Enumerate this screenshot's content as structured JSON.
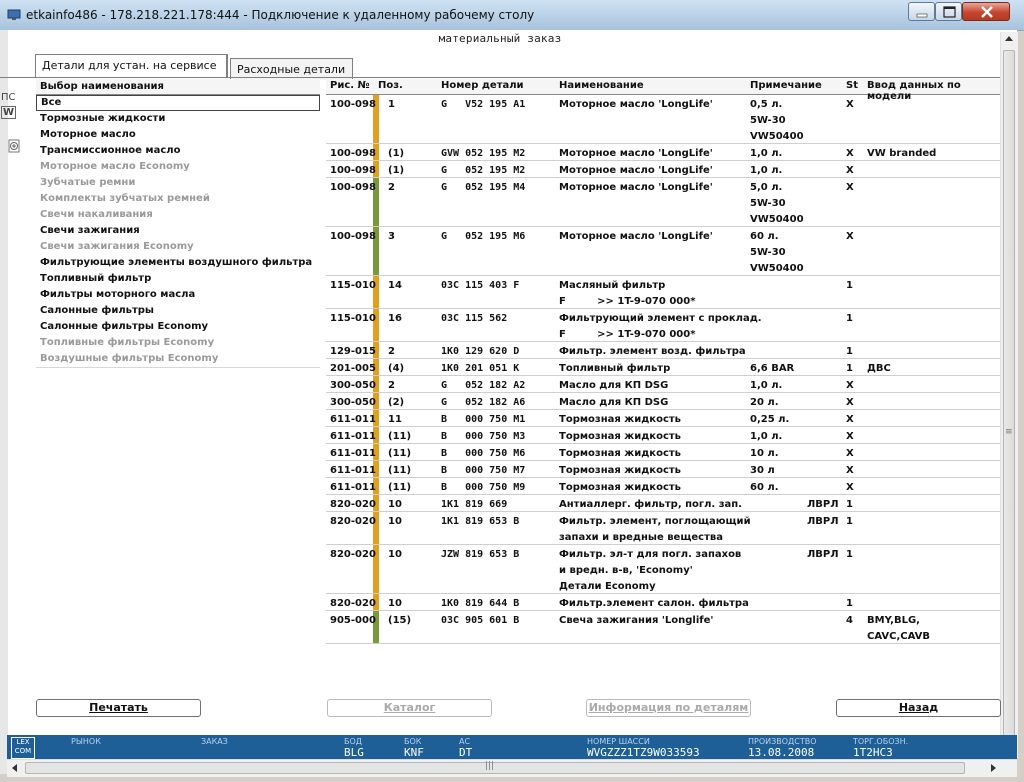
{
  "window": {
    "title": "etkainfo486 - 178.218.221.178:444 - Подключение к удаленному рабочему столу"
  },
  "page_title": "материальный заказ",
  "tabs": [
    {
      "label": "Детали для устан. на сервисе",
      "active": true
    },
    {
      "label": "Расходные детали",
      "active": false
    }
  ],
  "left_panel": {
    "header": "Выбор наименования",
    "items": [
      {
        "label": "Все",
        "enabled": true,
        "selected": true
      },
      {
        "label": "Тормозные жидкости",
        "enabled": true
      },
      {
        "label": "Моторное масло",
        "enabled": true
      },
      {
        "label": "Трансмиссионное масло",
        "enabled": true
      },
      {
        "label": "Моторное масло Economy",
        "enabled": false
      },
      {
        "label": "Зубчатые ремни",
        "enabled": false
      },
      {
        "label": "Комплекты зубчатых ремней",
        "enabled": false
      },
      {
        "label": "Свечи накаливания",
        "enabled": false
      },
      {
        "label": "Свечи зажигания",
        "enabled": true
      },
      {
        "label": "Свечи зажигания Economy",
        "enabled": false
      },
      {
        "label": "Фильтрующие элементы воздушного фильтра",
        "enabled": true
      },
      {
        "label": "Топливный фильтр",
        "enabled": true
      },
      {
        "label": "Фильтры моторного масла",
        "enabled": true
      },
      {
        "label": "Салонные фильтры",
        "enabled": true
      },
      {
        "label": "Салонные фильтры Economy",
        "enabled": true
      },
      {
        "label": "Топливные фильтры Economy",
        "enabled": false
      },
      {
        "label": "Воздушные фильтры Economy",
        "enabled": false
      }
    ]
  },
  "grid": {
    "columns": [
      "Рис. №",
      "Поз.",
      "Номер детали",
      "Наименование",
      "Примечание",
      "St",
      "Ввод данных по модели"
    ],
    "colors": {
      "orange": "#e0a020",
      "green": "#7a9a3a"
    },
    "rows": [
      {
        "fig": "100-098",
        "bar": "orange",
        "pos": "1",
        "part": "G   V52 195 A1",
        "name": [
          "Моторное масло 'LongLife'"
        ],
        "note": [
          "0,5 л.",
          "5W-30",
          "VW50400"
        ],
        "st": "X",
        "model": []
      },
      {
        "fig": "100-098",
        "bar": "orange",
        "pos": "(1)",
        "part": "GVW 052 195 M2",
        "name": [
          "Моторное масло 'LongLife'"
        ],
        "note": [
          "1,0 л."
        ],
        "st": "X",
        "model": [
          "VW branded"
        ]
      },
      {
        "fig": "100-098",
        "bar": "orange",
        "pos": "(1)",
        "part": "G   052 195 M2",
        "name": [
          "Моторное масло 'LongLife'"
        ],
        "note": [
          "1,0 л."
        ],
        "st": "X",
        "model": []
      },
      {
        "fig": "100-098",
        "bar": "green",
        "pos": "2",
        "part": "G   052 195 M4",
        "name": [
          "Моторное масло 'LongLife'"
        ],
        "note": [
          "5,0 л.",
          "5W-30",
          "VW50400"
        ],
        "st": "X",
        "model": []
      },
      {
        "fig": "100-098",
        "bar": "green",
        "pos": "3",
        "part": "G   052 195 M6",
        "name": [
          "Моторное масло 'LongLife'"
        ],
        "note": [
          "60 л.",
          "5W-30",
          "VW50400"
        ],
        "st": "X",
        "model": []
      },
      {
        "fig": "115-010",
        "bar": "orange",
        "pos": "14",
        "part": "03C 115 403 F",
        "name": [
          "Масляный фильтр",
          "F         >> 1T-9-070 000*"
        ],
        "note": [],
        "st": "1",
        "model": []
      },
      {
        "fig": "115-010",
        "bar": "orange",
        "pos": "16",
        "part": "03C 115 562",
        "name": [
          "Фильтрующий элемент с проклад.",
          "F         >> 1T-9-070 000*"
        ],
        "note": [],
        "st": "1",
        "model": []
      },
      {
        "fig": "129-015",
        "bar": "orange",
        "pos": "2",
        "part": "1K0 129 620 D",
        "name": [
          "Фильтр. элемент возд. фильтра"
        ],
        "note": [],
        "st": "1",
        "model": []
      },
      {
        "fig": "201-005",
        "bar": "orange",
        "pos": "(4)",
        "part": "1K0 201 051 K",
        "name": [
          "Топливный фильтр"
        ],
        "note": [
          "6,6 BAR"
        ],
        "st": "1",
        "model": [
          "ДВС"
        ]
      },
      {
        "fig": "300-050",
        "bar": "orange",
        "pos": "2",
        "part": "G   052 182 A2",
        "name": [
          "Масло для КП DSG"
        ],
        "note": [
          "1,0 л."
        ],
        "st": "X",
        "model": []
      },
      {
        "fig": "300-050",
        "bar": "orange",
        "pos": "(2)",
        "part": "G   052 182 A6",
        "name": [
          "Масло для КП DSG"
        ],
        "note": [
          "20 л."
        ],
        "st": "X",
        "model": []
      },
      {
        "fig": "611-011",
        "bar": "orange",
        "pos": "11",
        "part": "B   000 750 M1",
        "name": [
          "Тормозная жидкость"
        ],
        "note": [
          "0,25 л."
        ],
        "st": "X",
        "model": []
      },
      {
        "fig": "611-011",
        "bar": "orange",
        "pos": "(11)",
        "part": "B   000 750 M3",
        "name": [
          "Тормозная жидкость"
        ],
        "note": [
          "1,0 л."
        ],
        "st": "X",
        "model": []
      },
      {
        "fig": "611-011",
        "bar": "orange",
        "pos": "(11)",
        "part": "B   000 750 M6",
        "name": [
          "Тормозная жидкость"
        ],
        "note": [
          "10 л."
        ],
        "st": "X",
        "model": []
      },
      {
        "fig": "611-011",
        "bar": "orange",
        "pos": "(11)",
        "part": "B   000 750 M7",
        "name": [
          "Тормозная жидкость"
        ],
        "note": [
          "30 л"
        ],
        "st": "X",
        "model": []
      },
      {
        "fig": "611-011",
        "bar": "orange",
        "pos": "(11)",
        "part": "B   000 750 M9",
        "name": [
          "Тормозная жидкость"
        ],
        "note": [
          "60 л."
        ],
        "st": "X",
        "model": []
      },
      {
        "fig": "820-020",
        "bar": "orange",
        "pos": "10",
        "part": "1K1 819 669",
        "name": [
          "Антиаллерг. фильтр, погл. зап."
        ],
        "note": [
          "ЛВРЛ"
        ],
        "note_right": true,
        "st": "1",
        "model": []
      },
      {
        "fig": "820-020",
        "bar": "orange",
        "pos": "10",
        "part": "1K1 819 653 B",
        "name": [
          "Фильтр. элемент, поглощающий",
          "запахи и вредные вещества"
        ],
        "note": [
          "ЛВРЛ"
        ],
        "note_right": true,
        "st": "1",
        "model": []
      },
      {
        "fig": "820-020",
        "bar": "orange",
        "pos": "10",
        "part": "JZW 819 653 B",
        "name": [
          "Фильтр. эл-т для погл. запахов",
          "и вредн. в-в, 'Economy'",
          "Детали Economy"
        ],
        "note": [
          "ЛВРЛ"
        ],
        "note_right": true,
        "st": "1",
        "model": []
      },
      {
        "fig": "820-020",
        "bar": "orange",
        "pos": "10",
        "part": "1K0 819 644 B",
        "name": [
          "Фильтр.элемент салон. фильтра"
        ],
        "note": [],
        "st": "1",
        "model": []
      },
      {
        "fig": "905-000",
        "bar": "green",
        "pos": "(15)",
        "part": "03C 905 601 B",
        "name": [
          "Свеча зажигания 'Longlife'"
        ],
        "note": [],
        "st": "4",
        "model": [
          "BMY,BLG,",
          "CAVC,CAVB"
        ]
      }
    ]
  },
  "buttons": {
    "print": "Печатать",
    "catalog": "Каталог",
    "parts_info": "Информация по деталям",
    "back": "Назад"
  },
  "status_bar": {
    "logo": "LEX COM",
    "market_label": "РЫНОК",
    "order_label": "ЗАКАЗ",
    "bod_label": "БОД",
    "bod_value": "BLG",
    "bok_label": "БОК",
    "bok_value": "KNF",
    "ac_label": "АС",
    "ac_value": "DT",
    "chassis_label": "НОМЕР ШАССИ",
    "chassis_value": "WVGZZZ1TZ9W033593",
    "production_label": "ПРОИЗВОДСТВО",
    "production_value": "13.08.2008",
    "trade_label": "ТОРГ.ОБОЗН.",
    "trade_value": "1T2HC3"
  },
  "side_fragments": [
    "ПС",
    "W"
  ]
}
